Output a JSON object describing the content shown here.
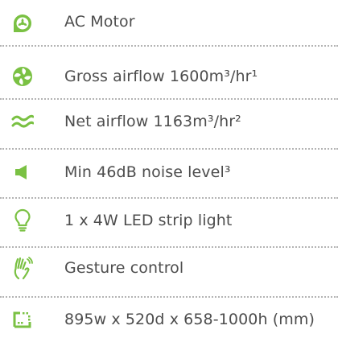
{
  "accent_color": "#7ac143",
  "features": [
    {
      "icon": "motor-icon",
      "label": "AC Motor"
    },
    {
      "icon": "airflow-icon",
      "label": "Gross airflow 1600m³/hr¹"
    },
    {
      "icon": "waves-icon",
      "label": "Net airflow 1163m³/hr²"
    },
    {
      "icon": "speaker-icon",
      "label": "Min 46dB noise level³"
    },
    {
      "icon": "lightbulb-icon",
      "label": "1 x 4W LED strip light"
    },
    {
      "icon": "hand-gesture-icon",
      "label": "Gesture control"
    },
    {
      "icon": "dimensions-icon",
      "label": "895w x 520d x 658-1000h (mm)"
    }
  ]
}
